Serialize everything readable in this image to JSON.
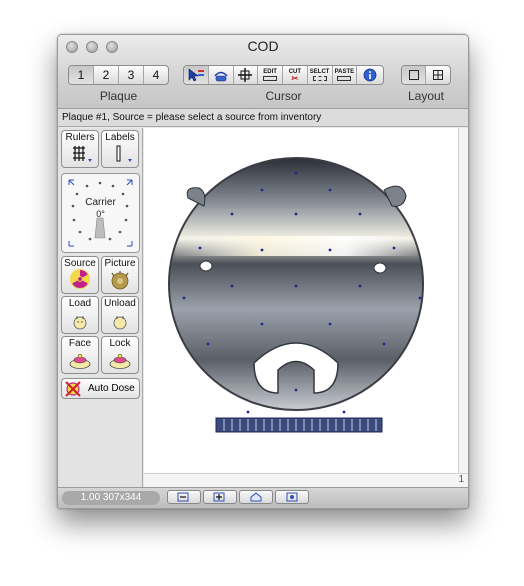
{
  "window": {
    "title": "COD"
  },
  "toolbar": {
    "plaque": {
      "label": "Plaque",
      "buttons": [
        "1",
        "2",
        "3",
        "4"
      ],
      "selected": "1"
    },
    "cursor": {
      "label": "Cursor",
      "tools": [
        {
          "name": "select-arrow-icon"
        },
        {
          "name": "rotate-hand-icon"
        },
        {
          "name": "move-crosshair-icon"
        },
        {
          "text": "EDIT"
        },
        {
          "text": "CUT"
        },
        {
          "text": "SELCT"
        },
        {
          "text": "PASTE"
        },
        {
          "name": "info-icon"
        }
      ]
    },
    "layout": {
      "label": "Layout",
      "selected": "single"
    }
  },
  "status": {
    "text": "Plaque #1, Source = please select a source from inventory"
  },
  "sidebar": {
    "rulers_label": "Rulers",
    "labels_label": "Labels",
    "carrier": {
      "label": "Carrier",
      "angle": "0°"
    },
    "source_label": "Source",
    "picture_label": "Picture",
    "load_label": "Load",
    "unload_label": "Unload",
    "face_label": "Face",
    "lock_label": "Lock",
    "autodose_label": "Auto Dose"
  },
  "canvas": {
    "page_number": "1"
  },
  "bottom": {
    "zoom_info": "1.00 307x344"
  },
  "colors": {
    "accent_blue": "#2f4fb8",
    "source_yellow": "#f2d94a",
    "source_magenta": "#c0208a"
  }
}
